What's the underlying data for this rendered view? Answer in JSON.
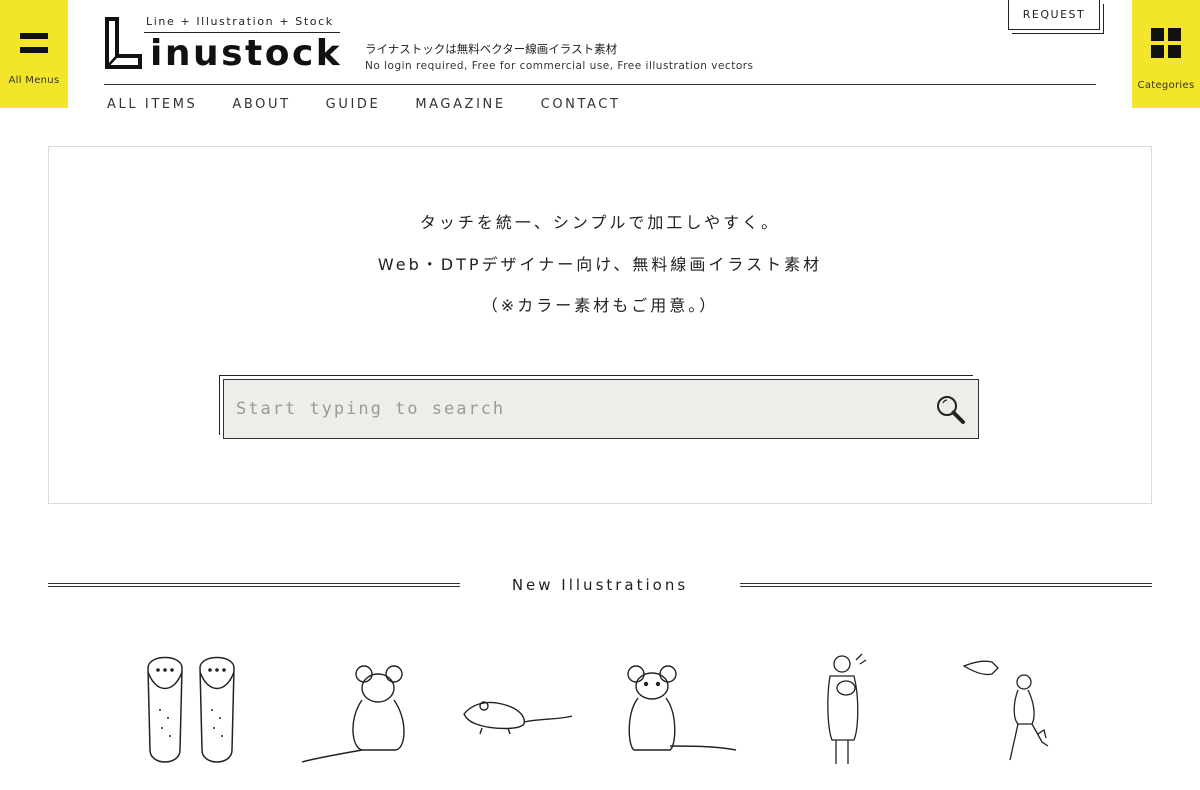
{
  "side": {
    "left_label": "All Menus",
    "right_label": "Categories"
  },
  "logo": {
    "tagline": "Line + Illustration + Stock",
    "wordmark": "inustock"
  },
  "tagline": {
    "jp": "ライナストックは無料ベクター線画イラスト素材",
    "en": "No login required, Free for commercial use, Free illustration vectors"
  },
  "request_label": "REQUEST",
  "nav": {
    "items": [
      "ALL ITEMS",
      "ABOUT",
      "GUIDE",
      "MAGAZINE",
      "CONTACT"
    ]
  },
  "hero": {
    "line1": "タッチを統一、シンプルで加工しやすく。",
    "line2": "Web・DTPデザイナー向け、無料線画イラスト素材",
    "line3": "（※カラー素材もご用意。）"
  },
  "search": {
    "placeholder": "Start typing to search"
  },
  "section": {
    "title": "New Illustrations"
  },
  "thumbnails": [
    "sandals-icon",
    "mouse-back-icon",
    "mouse-running-icon",
    "mouse-sitting-icon",
    "woman-holding-cat-icon",
    "man-kicking-icon"
  ]
}
